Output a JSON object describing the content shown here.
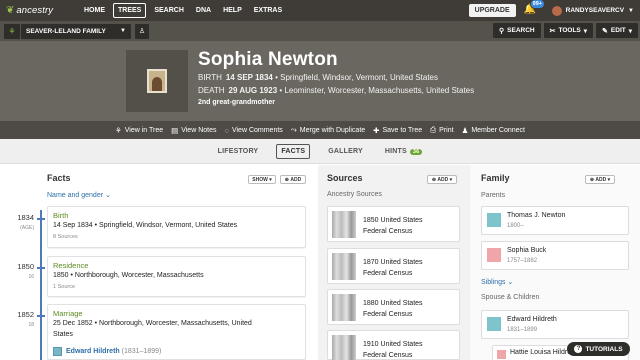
{
  "nav": {
    "logo": "ancestry",
    "links": [
      "HOME",
      "TREES",
      "SEARCH",
      "DNA",
      "HELP",
      "EXTRAS"
    ],
    "active": "TREES",
    "upgrade": "UPGRADE",
    "notification_count": "99+",
    "username": "RANDYSEAVERCV"
  },
  "treebar": {
    "tree_name": "SEAVER-LELAND FAMILY",
    "search": "SEARCH",
    "tools": "TOOLS",
    "edit": "EDIT"
  },
  "person": {
    "name": "Sophia Newton",
    "birth_label": "BIRTH",
    "birth_date": "14 SEP 1834",
    "birth_place": "• Springfield, Windsor, Vermont, United States",
    "death_label": "DEATH",
    "death_date": "29 AUG 1923",
    "death_place": "• Leominster, Worcester, Massachusetts, United States",
    "relationship": "2nd great-grandmother"
  },
  "actions": [
    "View in Tree",
    "View Notes",
    "View Comments",
    "Merge with Duplicate",
    "Save to Tree",
    "Print",
    "Member Connect"
  ],
  "tabs": [
    {
      "label": "LIFESTORY"
    },
    {
      "label": "FACTS"
    },
    {
      "label": "GALLERY"
    },
    {
      "label": "HINTS",
      "count": "36"
    }
  ],
  "facts": {
    "title": "Facts",
    "show": "SHOW",
    "add": "ADD",
    "name_gender": "Name and gender",
    "items": [
      {
        "year": "1834",
        "age": "(AGE)",
        "type": "Birth",
        "detail": "14 Sep 1834 • Springfield, Windsor, Vermont, United States",
        "sources": "8 Sources"
      },
      {
        "year": "1850",
        "age": "16",
        "type": "Residence",
        "detail": "1850 • Northborough, Worcester, Massachusetts",
        "sources": "1 Source"
      },
      {
        "year": "1852",
        "age": "18",
        "type": "Marriage",
        "detail": "25 Dec 1852 • Northborough, Worcester, Massachusetts, United",
        "detail2": "States",
        "spouse": "Edward Hildreth",
        "spouse_years": "(1831–1899)"
      }
    ]
  },
  "sources": {
    "title": "Sources",
    "add": "ADD",
    "subtitle": "Ancestry Sources",
    "items": [
      {
        "line1": "1850 United States",
        "line2": "Federal Census"
      },
      {
        "line1": "1870 United States",
        "line2": "Federal Census"
      },
      {
        "line1": "1880 United States",
        "line2": "Federal Census"
      },
      {
        "line1": "1910 United States",
        "line2": "Federal Census"
      }
    ]
  },
  "family": {
    "title": "Family",
    "add": "ADD",
    "parents_label": "Parents",
    "parents": [
      {
        "name": "Thomas J. Newton",
        "years": "1800–"
      },
      {
        "name": "Sophia Buck",
        "years": "1757–1882"
      }
    ],
    "siblings_label": "Siblings",
    "spouse_children_label": "Spouse & Children",
    "spouse": {
      "name": "Edward Hildreth",
      "years": "1831–1899"
    },
    "child": {
      "name": "Hattie Louisa Hildreth"
    }
  },
  "tutorials": "TUTORIALS"
}
